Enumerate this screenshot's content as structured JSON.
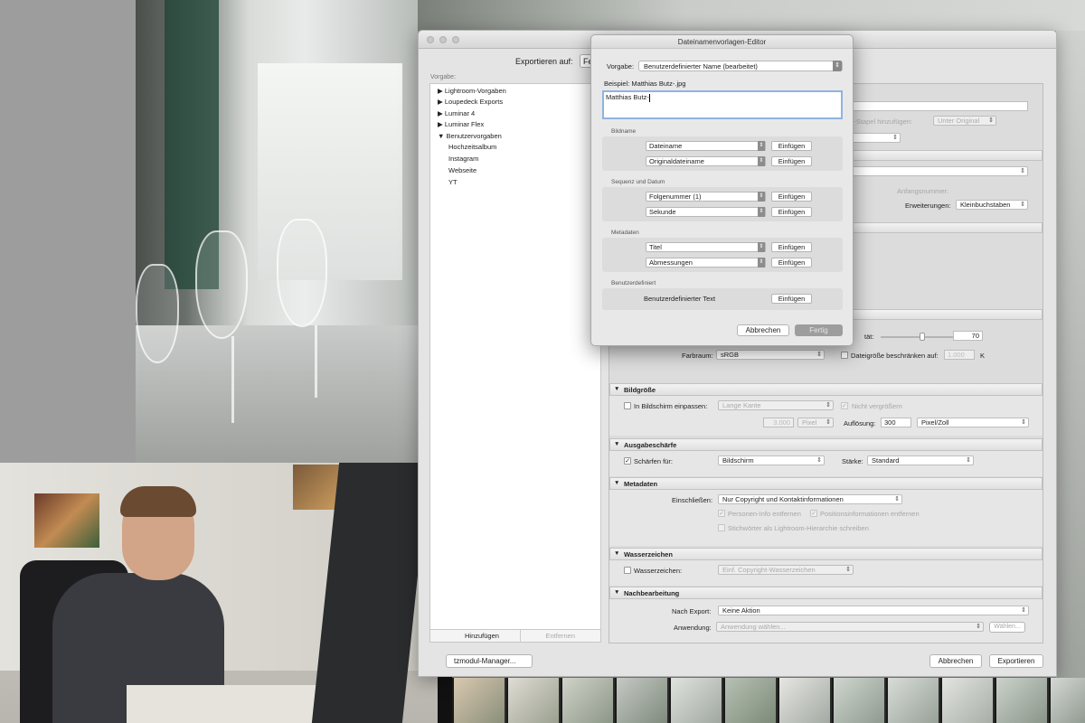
{
  "export_dialog": {
    "export_to_label": "Exportieren auf:",
    "export_to_value": "Fe",
    "preset_header": "Vorgabe:",
    "presets": [
      {
        "label": "Lightroom-Vorgaben",
        "expanded": false
      },
      {
        "label": "Loupedeck Exports",
        "expanded": false
      },
      {
        "label": "Luminar 4",
        "expanded": false
      },
      {
        "label": "Luminar Flex",
        "expanded": false
      },
      {
        "label": "Benutzervorgaben",
        "expanded": true
      }
    ],
    "user_presets": [
      "Hochzeitsalbum",
      "Instagram",
      "Webseite",
      "YT"
    ],
    "add_button": "Hinzufügen",
    "remove_button": "Entfernen",
    "manager_button": "tzmodul-Manager...",
    "cancel_button": "Abbrechen",
    "export_button": "Exportieren",
    "hidden_fragments": {
      "stack_label": "en-Stapel hinzufügen:",
      "stack_value": "Unter Original",
      "start_number_label": "Anfangsnummer:",
      "extensions_label": "Erweiterungen:",
      "extensions_value": "Kleinbuchstaben",
      "quality_label": "tät:",
      "quality_value": "70"
    },
    "file_settings": {
      "color_space_label": "Farbraum:",
      "color_space_value": "sRGB",
      "limit_size_label": "Dateigröße beschränken auf:",
      "limit_size_value": "1.000",
      "limit_size_unit": "K"
    },
    "sections": {
      "image_size": {
        "title": "Bildgröße",
        "fit_label": "In Bildschirm einpassen:",
        "fit_value": "Lange Kante",
        "no_enlarge_label": "Nicht vergrößern",
        "size_value": "3.000",
        "size_unit": "Pixel",
        "resolution_label": "Auflösung:",
        "resolution_value": "300",
        "resolution_unit": "Pixel/Zoll"
      },
      "sharpening": {
        "title": "Ausgabeschärfe",
        "sharpen_for_label": "Schärfen für:",
        "sharpen_for_value": "Bildschirm",
        "amount_label": "Stärke:",
        "amount_value": "Standard"
      },
      "metadata": {
        "title": "Metadaten",
        "include_label": "Einschließen:",
        "include_value": "Nur Copyright und Kontaktinformationen",
        "remove_person_label": "Personen-Info entfernen",
        "remove_location_label": "Positionsinformationen entfernen",
        "keywords_label": "Stichwörter als Lightroom-Hierarchie schreiben"
      },
      "watermark": {
        "title": "Wasserzeichen",
        "watermark_label": "Wasserzeichen:",
        "watermark_value": "Einf. Copyright-Wasserzeichen"
      },
      "post_processing": {
        "title": "Nachbearbeitung",
        "after_export_label": "Nach Export:",
        "after_export_value": "Keine Aktion",
        "application_label": "Anwendung:",
        "application_value": "Anwendung wählen...",
        "choose_button": "Wählen..."
      }
    }
  },
  "editor": {
    "title": "Dateinamenvorlagen-Editor",
    "preset_label": "Vorgabe:",
    "preset_value": "Benutzerdefinierter Name (bearbeitet)",
    "example_label": "Beispiel: Matthias Butz-.jpg",
    "token_text": "Matthias Butz-",
    "groups": [
      {
        "title": "Bildname",
        "rows": [
          "Dateiname",
          "Originaldateiname"
        ]
      },
      {
        "title": "Sequenz und Datum",
        "rows": [
          "Folgenummer (1)",
          "Sekunde"
        ]
      },
      {
        "title": "Metadaten",
        "rows": [
          "Titel",
          "Abmessungen"
        ]
      }
    ],
    "custom_group_title": "Benutzerdefiniert",
    "custom_text_label": "Benutzerdefinierter Text",
    "insert_label": "Einfügen",
    "cancel_button": "Abbrechen",
    "done_button": "Fertig"
  }
}
